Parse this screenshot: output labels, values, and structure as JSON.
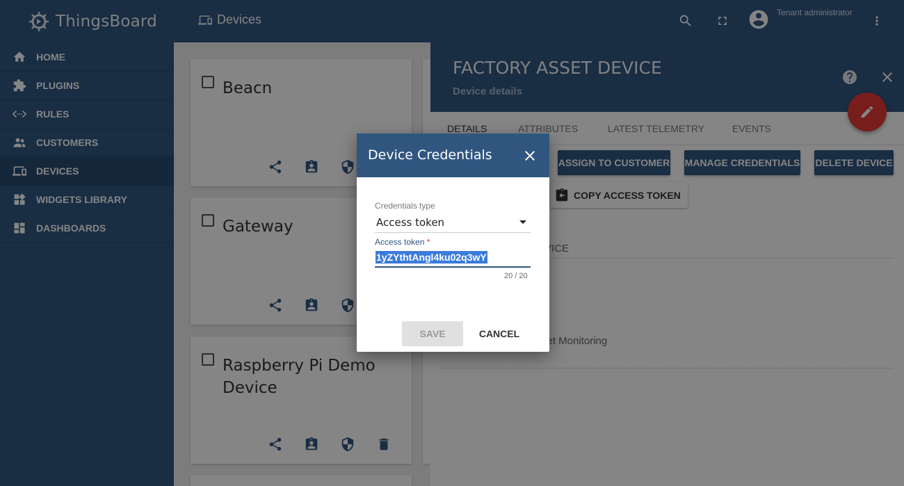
{
  "app": {
    "brand": "ThingsBoard"
  },
  "sidebar": {
    "items": [
      {
        "label": "HOME",
        "icon": "home-icon"
      },
      {
        "label": "PLUGINS",
        "icon": "puzzle-icon"
      },
      {
        "label": "RULES",
        "icon": "rules-icon"
      },
      {
        "label": "CUSTOMERS",
        "icon": "customers-icon"
      },
      {
        "label": "DEVICES",
        "icon": "devices-icon",
        "active": true
      },
      {
        "label": "WIDGETS LIBRARY",
        "icon": "widgets-icon"
      },
      {
        "label": "DASHBOARDS",
        "icon": "dashboards-icon"
      }
    ]
  },
  "topbar": {
    "title": "Devices",
    "user": "Tenant administrator"
  },
  "devices": [
    {
      "name": "Beacn"
    },
    {
      "name": "Gateway"
    },
    {
      "name": "Raspberry Pi Demo Device"
    }
  ],
  "details": {
    "title": "FACTORY ASSET DEVICE",
    "subtitle": "Device details",
    "tabs": [
      "DETAILS",
      "ATTRIBUTES",
      "LATEST TELEMETRY",
      "EVENTS"
    ],
    "buttons": {
      "assign": "ASSIGN TO CUSTOMER",
      "manage": "MANAGE CREDENTIALS",
      "delete": "DELETE DEVICE",
      "copy": "COPY ACCESS TOKEN"
    },
    "field_fragment_1": "VICE",
    "field_fragment_2": "set Monitoring"
  },
  "dialog": {
    "title": "Device Credentials",
    "credentials_type_label": "Credentials type",
    "credentials_type_value": "Access token",
    "access_token_label": "Access token",
    "required_mark": "*",
    "access_token_value": "1yZYthtAngl4ku02q3wY",
    "counter": "20 / 20",
    "save_label": "SAVE",
    "cancel_label": "CANCEL"
  },
  "colors": {
    "primary": "#305680",
    "accent": "#e53935",
    "selection": "#3b7bdb"
  }
}
